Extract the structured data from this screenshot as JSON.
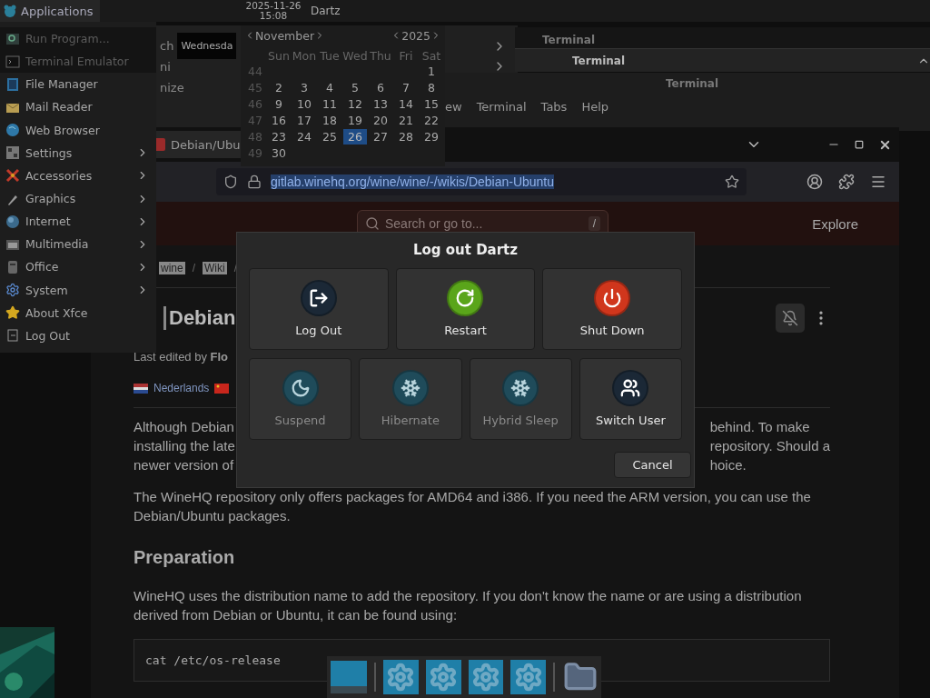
{
  "panel": {
    "menu_button": "Applications",
    "date": "2025-11-26",
    "time": "15:08",
    "user": "Dartz"
  },
  "back_window": {
    "line_1": "ch",
    "date_field": "Wednesda",
    "line_2": "ni",
    "line_3": "nize"
  },
  "terminal_back": {
    "title": "Terminal"
  },
  "terminal_mid": {
    "title": "Terminal"
  },
  "terminal_front": {
    "title": "Terminal",
    "menu": [
      "ew",
      "Terminal",
      "Tabs",
      "Help"
    ]
  },
  "browser": {
    "tab": {
      "title": "Debian/Ubu"
    },
    "address": {
      "url": "gitlab.winehq.org/wine/wine/-/wikis/Debian-Ubuntu",
      "highlighted": true
    },
    "site_header": {
      "search_placeholder": "Search or go to...",
      "shortcut": "/",
      "explore": "Explore"
    },
    "breadcrumbs": [
      {
        "label": "wine",
        "highlighted": true,
        "separator": "/"
      },
      {
        "label": "Wiki",
        "highlighted": true,
        "separator": "/"
      }
    ],
    "title": "Debian",
    "last_edited": "Last edited by **Flo**",
    "languages": [
      {
        "kind": "nl",
        "label": "Nederlands"
      },
      {
        "kind": "cn"
      }
    ],
    "paragraph_1": {
      "left_lines": [
        "Although Debian",
        "installing the late",
        "newer version of"
      ],
      "right_lines": [
        "behind. To make",
        "repository. Should a",
        "hoice."
      ]
    },
    "paragraph_2": "The WineHQ repository only offers packages for AMD64 and i386. If you need the ARM version, you can use the Debian/Ubuntu packages.",
    "heading": "Preparation",
    "paragraph_3": "WineHQ uses the distribution name to add the repository. If you don't know the name or are using a distribution derived from Debian or Ubuntu, it can be found using:",
    "code": "cat /etc/os-release"
  },
  "apps_menu": [
    {
      "kind": "run",
      "label": "Run Program...",
      "submenu": false,
      "dimmed": true
    },
    {
      "kind": "terminal",
      "label": "Terminal Emulator",
      "submenu": false,
      "dimmed": true
    },
    {
      "kind": "files",
      "label": "File Manager",
      "submenu": false,
      "dimmed": false
    },
    {
      "kind": "mail",
      "label": "Mail Reader",
      "submenu": false,
      "dimmed": false
    },
    {
      "kind": "web",
      "label": "Web Browser",
      "submenu": false,
      "dimmed": false
    },
    {
      "kind": "settings",
      "label": "Settings",
      "submenu": true,
      "dimmed": false
    },
    {
      "kind": "accessories",
      "label": "Accessories",
      "submenu": true,
      "dimmed": false
    },
    {
      "kind": "graphics",
      "label": "Graphics",
      "submenu": true,
      "dimmed": false
    },
    {
      "kind": "internet",
      "label": "Internet",
      "submenu": true,
      "dimmed": false
    },
    {
      "kind": "multimedia",
      "label": "Multimedia",
      "submenu": true,
      "dimmed": false
    },
    {
      "kind": "office",
      "label": "Office",
      "submenu": true,
      "dimmed": false
    },
    {
      "kind": "system",
      "label": "System",
      "submenu": true,
      "dimmed": false
    },
    {
      "kind": "about",
      "label": "About Xfce",
      "submenu": false,
      "dimmed": false
    },
    {
      "kind": "logout",
      "label": "Log Out",
      "submenu": false,
      "dimmed": false
    }
  ],
  "calendar": {
    "month": "November",
    "year": "2025",
    "weekdays": [
      "Sun",
      "Mon",
      "Tue",
      "Wed",
      "Thu",
      "Fri",
      "Sat"
    ],
    "weeks": [
      {
        "number": "44",
        "kind": "first",
        "days": [
          {
            "label": "1",
            "selected": false
          }
        ]
      },
      {
        "number": "45",
        "days": [
          {
            "label": "2",
            "selected": false
          },
          {
            "label": "3",
            "selected": false
          },
          {
            "label": "4",
            "selected": false
          },
          {
            "label": "5",
            "selected": false
          },
          {
            "label": "6",
            "selected": false
          },
          {
            "label": "7",
            "selected": false
          },
          {
            "label": "8",
            "selected": false
          }
        ]
      },
      {
        "number": "46",
        "days": [
          {
            "label": "9",
            "selected": false
          },
          {
            "label": "10",
            "selected": false
          },
          {
            "label": "11",
            "selected": false
          },
          {
            "label": "12",
            "selected": false
          },
          {
            "label": "13",
            "selected": false
          },
          {
            "label": "14",
            "selected": false
          },
          {
            "label": "15",
            "selected": false
          }
        ]
      },
      {
        "number": "47",
        "days": [
          {
            "label": "16",
            "selected": false
          },
          {
            "label": "17",
            "selected": false
          },
          {
            "label": "18",
            "selected": false
          },
          {
            "label": "19",
            "selected": false
          },
          {
            "label": "20",
            "selected": false
          },
          {
            "label": "21",
            "selected": false
          },
          {
            "label": "22",
            "selected": false
          }
        ]
      },
      {
        "number": "48",
        "days": [
          {
            "label": "23",
            "selected": false
          },
          {
            "label": "24",
            "selected": false
          },
          {
            "label": "25",
            "selected": false
          },
          {
            "label": "26",
            "selected": true
          },
          {
            "label": "27",
            "selected": false
          },
          {
            "label": "28",
            "selected": false
          },
          {
            "label": "29",
            "selected": false
          }
        ]
      },
      {
        "number": "49",
        "days": [
          {
            "label": "30",
            "selected": false
          }
        ]
      }
    ]
  },
  "logout_dialog": {
    "title": "Log out Dartz",
    "primary_actions": [
      {
        "kind": "logout",
        "label": "Log Out",
        "disabled": false
      },
      {
        "kind": "restart",
        "label": "Restart",
        "disabled": false
      },
      {
        "kind": "shutdown",
        "label": "Shut Down",
        "disabled": false
      }
    ],
    "secondary_actions": [
      {
        "kind": "suspend",
        "label": "Suspend",
        "disabled": true
      },
      {
        "kind": "hibernate",
        "label": "Hibernate",
        "disabled": true
      },
      {
        "kind": "hybrid",
        "label": "Hybrid Sleep",
        "disabled": true
      },
      {
        "kind": "switch",
        "label": "Switch User",
        "disabled": false
      }
    ],
    "cancel": "Cancel"
  },
  "dock": [
    {
      "kind": "window"
    },
    {
      "kind": "separator"
    },
    {
      "kind": "settings"
    },
    {
      "kind": "settings"
    },
    {
      "kind": "settings"
    },
    {
      "kind": "settings"
    },
    {
      "kind": "separator"
    },
    {
      "kind": "folder"
    }
  ]
}
